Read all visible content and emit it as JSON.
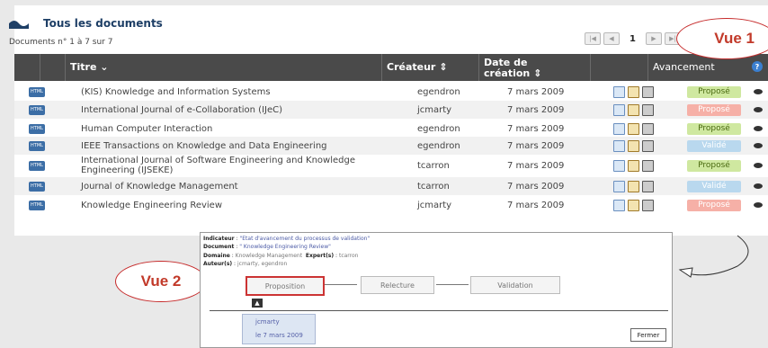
{
  "page": {
    "title": "Tous les documents",
    "doc_count": "Documents n° 1 à 7 sur 7",
    "pager": {
      "first": "|◀",
      "prev": "◀",
      "page": "1",
      "next": "▶",
      "last": "▶|"
    }
  },
  "table": {
    "headers": {
      "titre": "Titre",
      "createur": "Créateur",
      "date": "Date de création",
      "avancement": "Avancement"
    },
    "rows": [
      {
        "title": "(KIS) Knowledge and Information Systems",
        "creator": "egendron",
        "date": "7 mars 2009",
        "status": "Proposé",
        "status_color": "#cfe8a0"
      },
      {
        "title": "International Journal of e-Collaboration (IJeC)",
        "creator": "jcmarty",
        "date": "7 mars 2009",
        "status": "Proposé",
        "status_color": "#f6b0a7"
      },
      {
        "title": "Human Computer Interaction",
        "creator": "egendron",
        "date": "7 mars 2009",
        "status": "Proposé",
        "status_color": "#cfe8a0"
      },
      {
        "title": "IEEE Transactions on Knowledge and Data Engineering",
        "creator": "egendron",
        "date": "7 mars 2009",
        "status": "Validé",
        "status_color": "#b9d8ee"
      },
      {
        "title": "International Journal of Software Engineering and Knowledge Engineering (IJSEKE)",
        "creator": "tcarron",
        "date": "7 mars 2009",
        "status": "Proposé",
        "status_color": "#cfe8a0"
      },
      {
        "title": "Journal of Knowledge Management",
        "creator": "tcarron",
        "date": "7 mars 2009",
        "status": "Validé",
        "status_color": "#b9d8ee"
      },
      {
        "title": "Knowledge Engineering Review",
        "creator": "jcmarty",
        "date": "7 mars 2009",
        "status": "Proposé",
        "status_color": "#f6b0a7"
      }
    ]
  },
  "callouts": {
    "vue1": "Vue 1",
    "vue2": "Vue 2"
  },
  "popup": {
    "indicateur_label": "Indicateur",
    "indicateur_value": "\"Etat d'avancement du processus de validation\"",
    "document_label": "Document",
    "document_value": "\" Knowledge Engineering Review\"",
    "domaine_label": "Domaine",
    "domaine_value": "Knowledge Management",
    "experts_label": "Expert(s)",
    "experts_value": "tcarron",
    "auteurs_label": "Auteur(s)",
    "auteurs_value": "jcmarty, egendron",
    "steps": [
      "Proposition",
      "Relecture",
      "Validation"
    ],
    "info_user": "jcmarty",
    "info_date": "le 7 mars 2009",
    "close": "Fermer"
  },
  "icons": {
    "html_icon": "html-file-icon",
    "view": "eye-icon",
    "help": "help-icon"
  }
}
